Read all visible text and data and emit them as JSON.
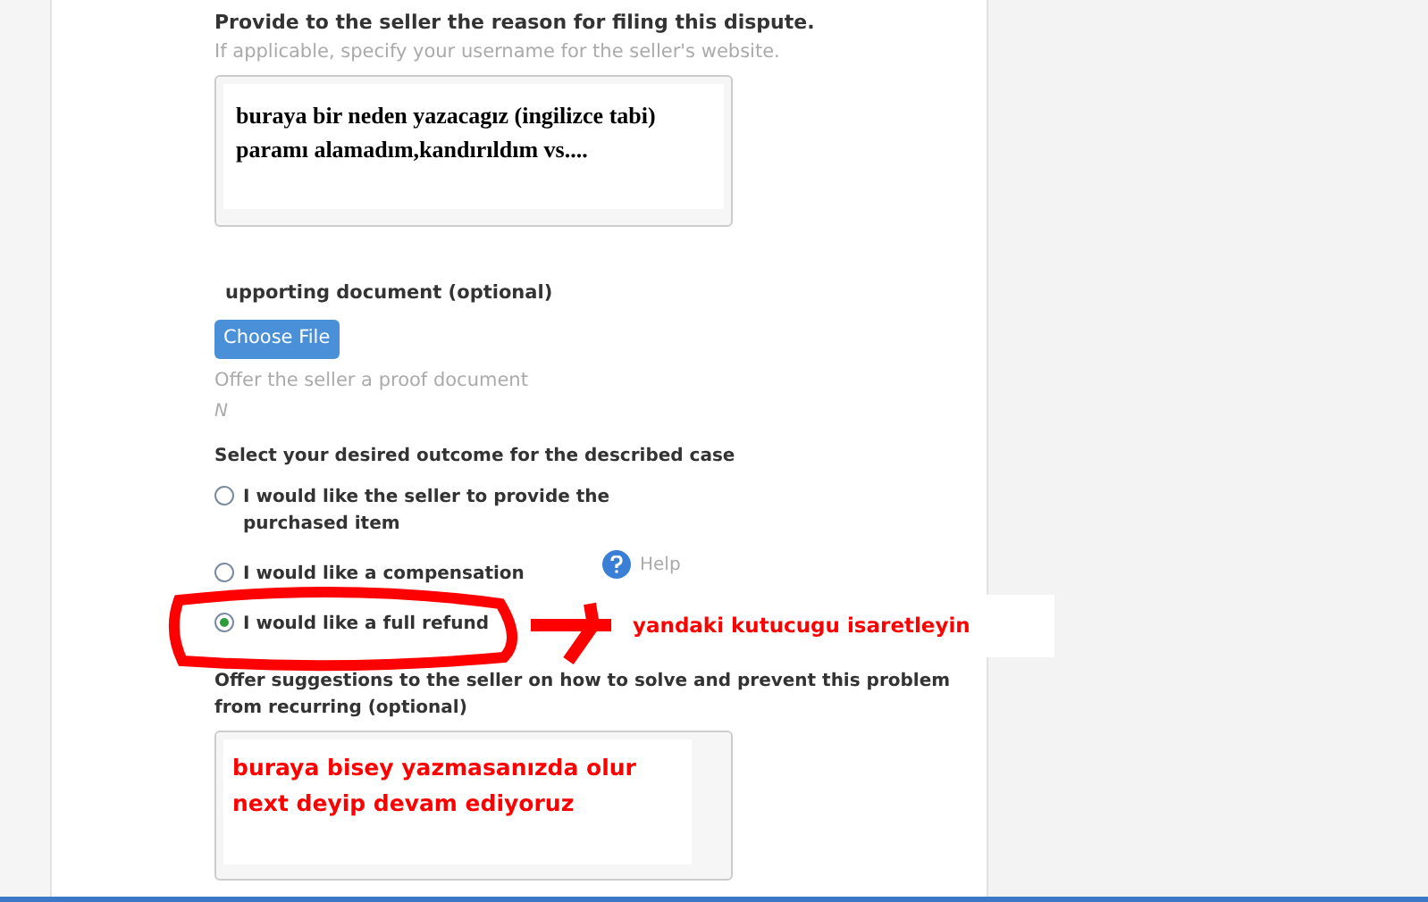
{
  "reason_section": {
    "title": "Provide to the seller the reason for filing this dispute.",
    "hint": "If applicable, specify your username for the seller's website.",
    "field_value": "buraya bir neden yazacagız (ingilizce tabi) paramı alamadım,kandırıldım vs...."
  },
  "document_section": {
    "title": "upporting document (optional)",
    "button": "Choose File",
    "hint": "Offer the seller a proof document",
    "hint_2": "N"
  },
  "outcome_section": {
    "title": "Select your desired outcome for the described case",
    "help": "Help",
    "options": [
      {
        "label": "I would like the seller to provide the purchased item",
        "selected": false
      },
      {
        "label": "I would like a compensation",
        "selected": false
      },
      {
        "label": "I would like a full refund",
        "selected": true
      }
    ]
  },
  "annotation": {
    "note": "yandaki kutucugu isaretleyin"
  },
  "suggestions_section": {
    "title": "Offer suggestions to the seller on how to solve and prevent this problem from recurring (optional)",
    "field_value": "buraya bisey yazmasanızda olur next deyip devam ediyoruz"
  }
}
